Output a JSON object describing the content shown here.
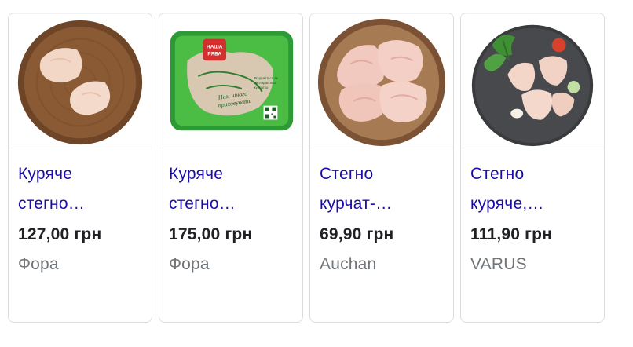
{
  "products": [
    {
      "title": "Куряче стегно…",
      "price": "127,00 грн",
      "store": "Фора",
      "image": "chicken-thighs-on-wooden-board-icon"
    },
    {
      "title": "Куряче стегно…",
      "price": "175,00 грн",
      "store": "Фора",
      "image": "packaged-chicken-thighs-icon",
      "package": {
        "brand_logo_text": "НАША РЯБА",
        "slogan": "Нам нічого приховувати",
        "side_text": "Роздивіться як виглядає наш курчатко"
      }
    },
    {
      "title": "Стегно курчат-…",
      "price": "69,90 грн",
      "store": "Auchan",
      "image": "chicken-thighs-on-round-board-icon"
    },
    {
      "title": "Стегно куряче,…",
      "price": "111,90 грн",
      "store": "VARUS",
      "image": "chicken-thighs-on-slate-plate-icon"
    }
  ],
  "colors": {
    "title": "#1a0dab",
    "price": "#202124",
    "store": "#70757a",
    "card_border": "#dadce0",
    "package_green": "#3fae3a"
  }
}
